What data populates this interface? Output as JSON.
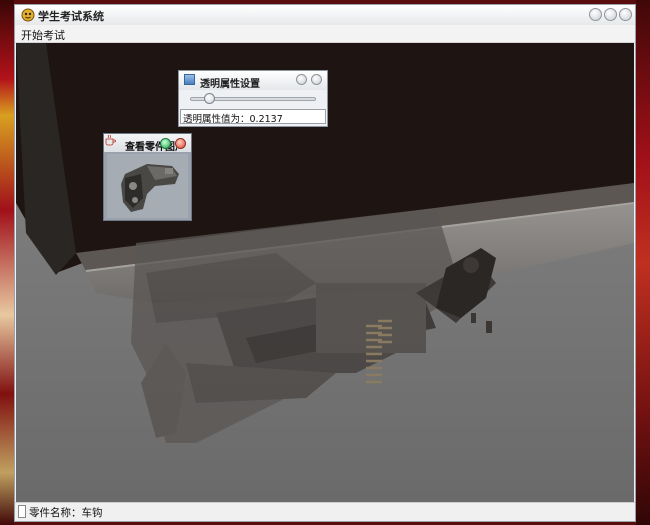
{
  "window": {
    "title": "学生考试系统",
    "menu_start_exam": "开始考试"
  },
  "transparency_dialog": {
    "title": "透明属性设置",
    "slider_value": 0.2137,
    "value_label": "透明属性值为：0.2137"
  },
  "part_window": {
    "title": "查看零件图片"
  },
  "status": {
    "part_name_label": "零件名称：车钩"
  },
  "colors": {
    "viewport_bg": "#7a7a7a",
    "frame_dark": "#1e1412"
  }
}
